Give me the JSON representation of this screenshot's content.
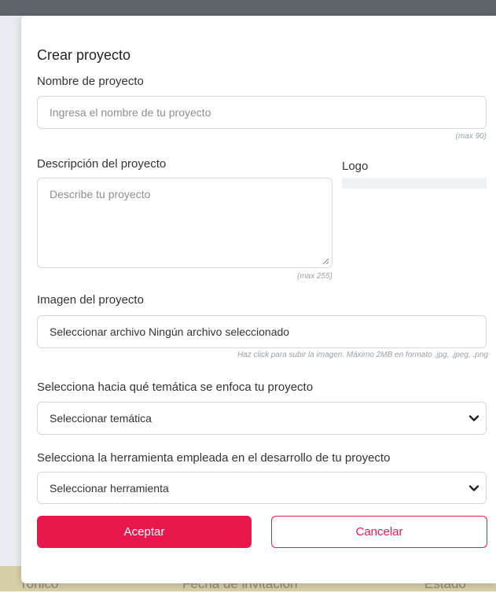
{
  "background": {
    "footer_cols": [
      "rónico",
      "Fecha de invitación",
      "Estado"
    ]
  },
  "modal": {
    "title": "Crear proyecto",
    "name": {
      "label": "Nombre de proyecto",
      "placeholder": "Ingresa el nombre de tu proyecto",
      "hint": "(max 90)"
    },
    "description": {
      "label": "Descripción del proyecto",
      "placeholder": "Describe tu proyecto",
      "hint": "(max 255)"
    },
    "logo": {
      "label": "Logo"
    },
    "image": {
      "label": "Imagen del proyecto",
      "value": "Seleccionar archivo Ningún archivo seleccionado",
      "hint": "Haz click para subir la imagen. Máximo 2MB en formato .jpg, .jpeg, .png"
    },
    "theme": {
      "label": "Selecciona hacia qué temática se enfoca tu proyecto",
      "selected": "Seleccionar temática"
    },
    "tool": {
      "label": "Selecciona la herramienta empleada en el desarrollo de tu proyecto",
      "selected": "Seleccionar herramienta"
    },
    "buttons": {
      "accept": "Aceptar",
      "cancel": "Cancelar"
    }
  },
  "colors": {
    "accent": "#e8184f",
    "border": "#d4d7dc",
    "overlay": "#e9ecf0"
  }
}
